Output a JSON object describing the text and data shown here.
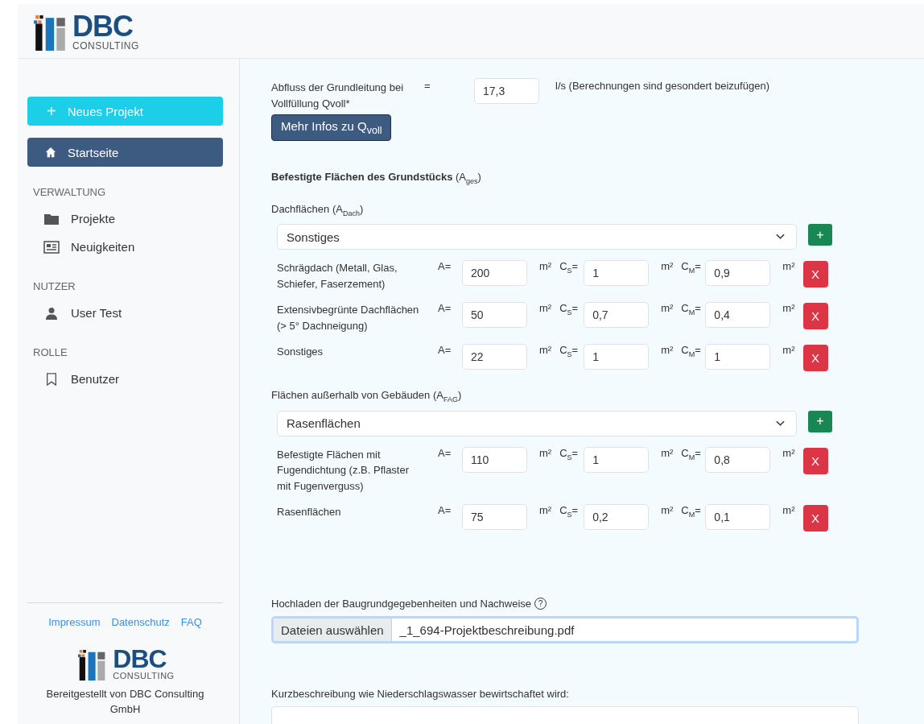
{
  "brand": {
    "name": "DBC",
    "sub": "CONSULTING"
  },
  "sidebar": {
    "new_button": {
      "icon": "+",
      "label": "Neues Projekt"
    },
    "home": {
      "label": "Startseite",
      "selected": true
    },
    "sections": [
      {
        "title": "VERWALTUNG",
        "items": [
          {
            "label": "Projekte",
            "kind": "folder",
            "selected": false
          },
          {
            "label": "Neuigkeiten",
            "kind": "news",
            "selected": false
          }
        ]
      },
      {
        "title": "NUTZER",
        "items": [
          {
            "label": "User Test",
            "kind": "user",
            "selected": false
          }
        ]
      },
      {
        "title": "ROLLE",
        "items": [
          {
            "label": "Benutzer",
            "kind": "bookmark",
            "selected": false
          }
        ]
      }
    ],
    "footer_links": [
      "Impressum",
      "Datenschutz",
      "FAQ"
    ],
    "footer_brand": {
      "name": "DBC",
      "sub": "CONSULTING"
    },
    "footer_text": "Bereitgestellt von DBC Consulting GmbH"
  },
  "flow": {
    "label": "Abfluss der Grundleitung bei Vollfüllung Qvoll*",
    "equals": "=",
    "value": "17,3",
    "unit": "l/s (Berechnungen sind gesondert beizufügen)",
    "info_button": "Mehr Infos zu Q$_{voll}$"
  },
  "areas_heading": "**Befestigte Flächen des Grundstücks** (A$_{ges}$)",
  "groups": [
    {
      "title": "Dachflächen (A$_{Dach}$)",
      "select": "Sonstiges",
      "add": "+",
      "rows": [
        {
          "label": "Schrägdach (Metall, Glas, Schiefer, Faserzement)",
          "fields": [
            {
              "label": "A=",
              "value": "200",
              "unit": "m²"
            },
            {
              "label": "C$_{S}$=",
              "value": "1",
              "unit": "m²"
            },
            {
              "label": "C$_{M}$=",
              "value": "0,9",
              "unit": "m²"
            }
          ],
          "remove": "X"
        },
        {
          "label": "Extensivbegrünte Dachflächen (> 5° Dachneigung)",
          "fields": [
            {
              "label": "A=",
              "value": "50",
              "unit": "m²"
            },
            {
              "label": "C$_{S}$=",
              "value": "0,7",
              "unit": "m²"
            },
            {
              "label": "C$_{M}$=",
              "value": "0,4",
              "unit": "m²"
            }
          ],
          "remove": "X"
        },
        {
          "label": "Sonstiges",
          "fields": [
            {
              "label": "A=",
              "value": "22",
              "unit": "m²"
            },
            {
              "label": "C$_{S}$=",
              "value": "1",
              "unit": "m²"
            },
            {
              "label": "C$_{M}$=",
              "value": "1",
              "unit": "m²"
            }
          ],
          "remove": "X"
        }
      ]
    },
    {
      "title": "Flächen außerhalb von Gebäuden (A$_{FAG}$)",
      "select": "Rasenflächen",
      "add": "+",
      "rows": [
        {
          "label": "Befestigte Flächen mit Fugendichtung (z.B. Pflaster mit Fugenverguss)",
          "fields": [
            {
              "label": "A=",
              "value": "110",
              "unit": "m²"
            },
            {
              "label": "C$_{S}$=",
              "value": "1",
              "unit": "m²"
            },
            {
              "label": "C$_{M}$=",
              "value": "0,8",
              "unit": "m²"
            }
          ],
          "remove": "X"
        },
        {
          "label": "Rasenflächen",
          "fields": [
            {
              "label": "A=",
              "value": "75",
              "unit": "m²"
            },
            {
              "label": "C$_{S}$=",
              "value": "0,2",
              "unit": "m²"
            },
            {
              "label": "C$_{M}$=",
              "value": "0,1",
              "unit": "m²"
            }
          ],
          "remove": "X"
        }
      ]
    }
  ],
  "upload": {
    "label": "Hochladen der Baugrundgegebenheiten und Nachweise",
    "help": "?",
    "button": "Dateien auswählen",
    "file": "_1_694-Projektbeschreibung.pdf"
  },
  "description": {
    "label": "Kurzbeschreibung wie Niederschlagswasser bewirtschaftet wird:"
  }
}
